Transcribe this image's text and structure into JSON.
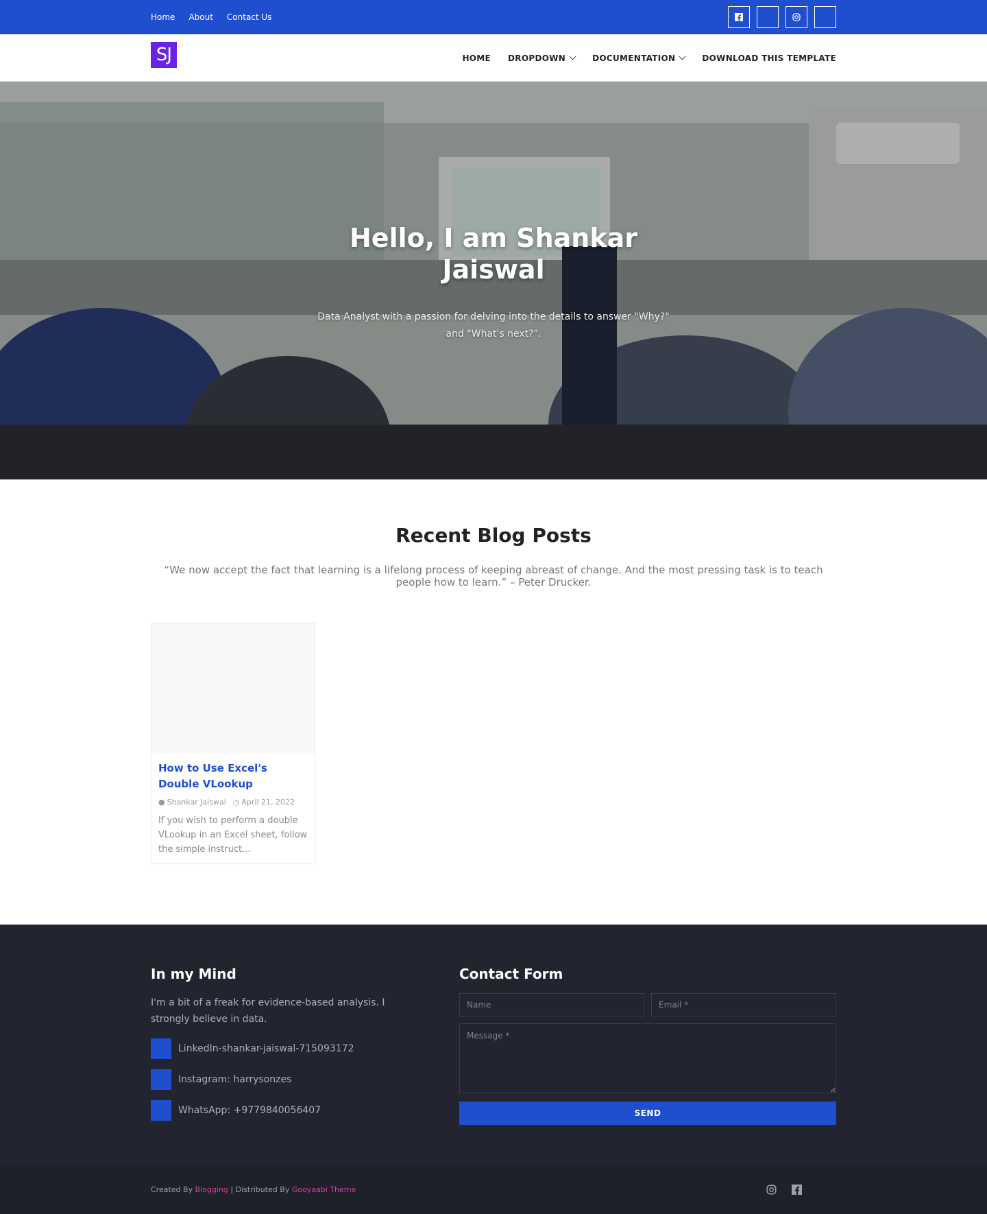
{
  "topbar": {
    "links": [
      "Home",
      "About",
      "Contact Us"
    ],
    "social": [
      "facebook-icon",
      "blank-icon",
      "instagram-icon",
      "blank-icon"
    ]
  },
  "header": {
    "logo": "SJ",
    "nav": {
      "home": "HOME",
      "dropdown": "DROPDOWN",
      "documentation": "DOCUMENTATION",
      "download": "DOWNLOAD THIS TEMPLATE"
    }
  },
  "hero": {
    "title": "Hello, I am Shankar Jaiswal",
    "subtitle": "Data Analyst with a passion for delving into the details to answer \"Why?\" and \"What's next?\"."
  },
  "blog": {
    "heading": "Recent Blog Posts",
    "quote": "“We now accept the fact that learning is a lifelong process of keeping abreast of change. And the most pressing task is to teach people how to learn.” – Peter Drucker.",
    "posts": [
      {
        "title": "How to Use Excel's Double VLookup",
        "author": "Shankar Jaiswal",
        "date": "April 21, 2022",
        "excerpt": "If you wish to perform a double VLookup in an Excel sheet, follow the simple instruct..."
      }
    ]
  },
  "footer": {
    "mind": {
      "heading": "In my Mind",
      "desc": "I'm a bit of a freak for evidence-based analysis. I strongly believe in data.",
      "items": [
        "LinkedIn-shankar-jaiswal-715093172",
        "Instagram: harrysonzes",
        "WhatsApp: +9779840056407"
      ]
    },
    "contact": {
      "heading": "Contact Form",
      "name_placeholder": "Name",
      "email_placeholder": "Email *",
      "message_placeholder": "Message *",
      "send": "SEND"
    }
  },
  "bottom": {
    "created_by": "Created By",
    "created_link": "Blogging",
    "separator": " | Distributed By",
    "distributed_link": "Gooyaabi Theme"
  },
  "colors": {
    "brand_blue": "#1f4fcf",
    "logo_purple": "#6a22e6",
    "footer_bg": "#22242f",
    "credit_pink": "#e03aa6"
  }
}
